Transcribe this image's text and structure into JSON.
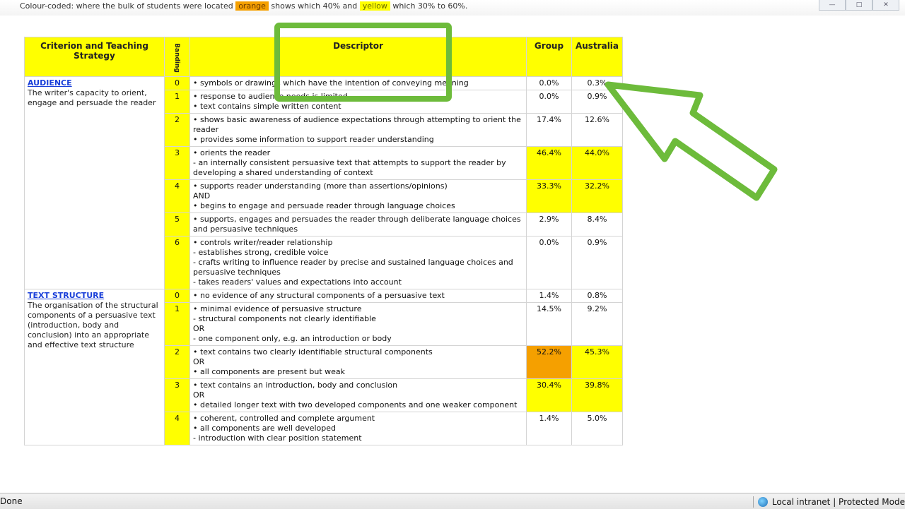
{
  "top_strip": {
    "text_before": "Colour-coded: where the bulk of students were located",
    "orange_label": "orange",
    "text_mid": "shows which 40% and",
    "yellow_label": "yellow",
    "text_end": "which 30% to 60%."
  },
  "table": {
    "headers": {
      "criterion": "Criterion and Teaching Strategy",
      "rating": "Banding",
      "descriptor": "Descriptor",
      "group": "Group",
      "australia": "Australia"
    },
    "criteria": [
      {
        "title": "AUDIENCE",
        "description": "The writer's capacity to orient, engage and persuade the reader",
        "rows": [
          {
            "score": "0",
            "descriptor": "• symbols or drawings which have the intention of conveying meaning",
            "group": "0.0%",
            "australia": "0.3%",
            "group_hl": "w",
            "aus_hl": "w"
          },
          {
            "score": "1",
            "descriptor": "• response to audience needs is limited\n• text contains simple written content",
            "group": "0.0%",
            "australia": "0.9%",
            "group_hl": "w",
            "aus_hl": "w"
          },
          {
            "score": "2",
            "descriptor": "• shows basic awareness of audience expectations through attempting to orient the reader\n• provides some information to support reader understanding",
            "group": "17.4%",
            "australia": "12.6%",
            "group_hl": "w",
            "aus_hl": "w"
          },
          {
            "score": "3",
            "descriptor": "• orients the reader\n- an internally consistent persuasive text that attempts to support the reader by developing a shared understanding of context",
            "group": "46.4%",
            "australia": "44.0%",
            "group_hl": "y",
            "aus_hl": "y"
          },
          {
            "score": "4",
            "descriptor": "• supports reader understanding (more than assertions/opinions)\nAND\n• begins to engage and persuade reader through language choices",
            "group": "33.3%",
            "australia": "32.2%",
            "group_hl": "y",
            "aus_hl": "y"
          },
          {
            "score": "5",
            "descriptor": "• supports, engages and persuades the reader through deliberate language choices and persuasive techniques",
            "group": "2.9%",
            "australia": "8.4%",
            "group_hl": "w",
            "aus_hl": "w"
          },
          {
            "score": "6",
            "descriptor": "• controls writer/reader relationship\n- establishes strong, credible voice\n- crafts writing to influence reader by precise and sustained language choices and persuasive techniques\n- takes readers' values and expectations into account",
            "group": "0.0%",
            "australia": "0.9%",
            "group_hl": "w",
            "aus_hl": "w"
          }
        ]
      },
      {
        "title": "TEXT STRUCTURE",
        "description": "The organisation of the structural components of a persuasive text (introduction, body and conclusion) into an appropriate and effective text structure",
        "rows": [
          {
            "score": "0",
            "descriptor": "• no evidence of any structural components of a persuasive text",
            "group": "1.4%",
            "australia": "0.8%",
            "group_hl": "w",
            "aus_hl": "w"
          },
          {
            "score": "1",
            "descriptor": "• minimal evidence of persuasive structure\n- structural components not clearly identifiable\nOR\n- one component only, e.g. an introduction or body",
            "group": "14.5%",
            "australia": "9.2%",
            "group_hl": "w",
            "aus_hl": "w"
          },
          {
            "score": "2",
            "descriptor": "• text contains two clearly identifiable structural components\nOR\n• all components are present but weak",
            "group": "52.2%",
            "australia": "45.3%",
            "group_hl": "o",
            "aus_hl": "y"
          },
          {
            "score": "3",
            "descriptor": "• text contains an introduction, body and conclusion\nOR\n• detailed longer text with two developed components and one weaker component",
            "group": "30.4%",
            "australia": "39.8%",
            "group_hl": "y",
            "aus_hl": "y"
          },
          {
            "score": "4",
            "descriptor": "• coherent, controlled and complete argument\n• all components are well developed\n- introduction with clear position statement",
            "group": "1.4%",
            "australia": "5.0%",
            "group_hl": "w",
            "aus_hl": "w"
          }
        ]
      }
    ]
  },
  "status_bar": {
    "left": "Done",
    "zone": "Local intranet | Protected Mode"
  },
  "colors": {
    "yellow": "#ffff00",
    "orange": "#f5a000",
    "annotation_green": "#6dbb3b"
  }
}
